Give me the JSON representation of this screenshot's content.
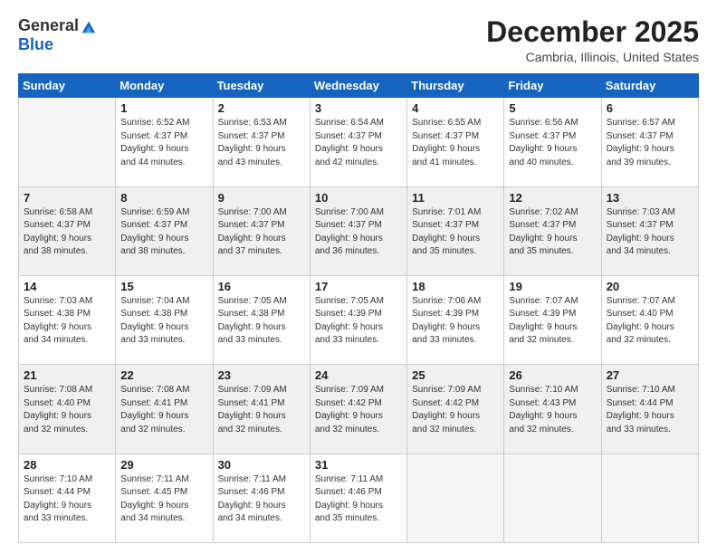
{
  "logo": {
    "general": "General",
    "blue": "Blue"
  },
  "header": {
    "month": "December 2025",
    "location": "Cambria, Illinois, United States"
  },
  "days_of_week": [
    "Sunday",
    "Monday",
    "Tuesday",
    "Wednesday",
    "Thursday",
    "Friday",
    "Saturday"
  ],
  "weeks": [
    [
      {
        "day": "",
        "info": ""
      },
      {
        "day": "1",
        "info": "Sunrise: 6:52 AM\nSunset: 4:37 PM\nDaylight: 9 hours\nand 44 minutes."
      },
      {
        "day": "2",
        "info": "Sunrise: 6:53 AM\nSunset: 4:37 PM\nDaylight: 9 hours\nand 43 minutes."
      },
      {
        "day": "3",
        "info": "Sunrise: 6:54 AM\nSunset: 4:37 PM\nDaylight: 9 hours\nand 42 minutes."
      },
      {
        "day": "4",
        "info": "Sunrise: 6:55 AM\nSunset: 4:37 PM\nDaylight: 9 hours\nand 41 minutes."
      },
      {
        "day": "5",
        "info": "Sunrise: 6:56 AM\nSunset: 4:37 PM\nDaylight: 9 hours\nand 40 minutes."
      },
      {
        "day": "6",
        "info": "Sunrise: 6:57 AM\nSunset: 4:37 PM\nDaylight: 9 hours\nand 39 minutes."
      }
    ],
    [
      {
        "day": "7",
        "info": "Sunrise: 6:58 AM\nSunset: 4:37 PM\nDaylight: 9 hours\nand 38 minutes."
      },
      {
        "day": "8",
        "info": "Sunrise: 6:59 AM\nSunset: 4:37 PM\nDaylight: 9 hours\nand 38 minutes."
      },
      {
        "day": "9",
        "info": "Sunrise: 7:00 AM\nSunset: 4:37 PM\nDaylight: 9 hours\nand 37 minutes."
      },
      {
        "day": "10",
        "info": "Sunrise: 7:00 AM\nSunset: 4:37 PM\nDaylight: 9 hours\nand 36 minutes."
      },
      {
        "day": "11",
        "info": "Sunrise: 7:01 AM\nSunset: 4:37 PM\nDaylight: 9 hours\nand 35 minutes."
      },
      {
        "day": "12",
        "info": "Sunrise: 7:02 AM\nSunset: 4:37 PM\nDaylight: 9 hours\nand 35 minutes."
      },
      {
        "day": "13",
        "info": "Sunrise: 7:03 AM\nSunset: 4:37 PM\nDaylight: 9 hours\nand 34 minutes."
      }
    ],
    [
      {
        "day": "14",
        "info": "Sunrise: 7:03 AM\nSunset: 4:38 PM\nDaylight: 9 hours\nand 34 minutes."
      },
      {
        "day": "15",
        "info": "Sunrise: 7:04 AM\nSunset: 4:38 PM\nDaylight: 9 hours\nand 33 minutes."
      },
      {
        "day": "16",
        "info": "Sunrise: 7:05 AM\nSunset: 4:38 PM\nDaylight: 9 hours\nand 33 minutes."
      },
      {
        "day": "17",
        "info": "Sunrise: 7:05 AM\nSunset: 4:39 PM\nDaylight: 9 hours\nand 33 minutes."
      },
      {
        "day": "18",
        "info": "Sunrise: 7:06 AM\nSunset: 4:39 PM\nDaylight: 9 hours\nand 33 minutes."
      },
      {
        "day": "19",
        "info": "Sunrise: 7:07 AM\nSunset: 4:39 PM\nDaylight: 9 hours\nand 32 minutes."
      },
      {
        "day": "20",
        "info": "Sunrise: 7:07 AM\nSunset: 4:40 PM\nDaylight: 9 hours\nand 32 minutes."
      }
    ],
    [
      {
        "day": "21",
        "info": "Sunrise: 7:08 AM\nSunset: 4:40 PM\nDaylight: 9 hours\nand 32 minutes."
      },
      {
        "day": "22",
        "info": "Sunrise: 7:08 AM\nSunset: 4:41 PM\nDaylight: 9 hours\nand 32 minutes."
      },
      {
        "day": "23",
        "info": "Sunrise: 7:09 AM\nSunset: 4:41 PM\nDaylight: 9 hours\nand 32 minutes."
      },
      {
        "day": "24",
        "info": "Sunrise: 7:09 AM\nSunset: 4:42 PM\nDaylight: 9 hours\nand 32 minutes."
      },
      {
        "day": "25",
        "info": "Sunrise: 7:09 AM\nSunset: 4:42 PM\nDaylight: 9 hours\nand 32 minutes."
      },
      {
        "day": "26",
        "info": "Sunrise: 7:10 AM\nSunset: 4:43 PM\nDaylight: 9 hours\nand 32 minutes."
      },
      {
        "day": "27",
        "info": "Sunrise: 7:10 AM\nSunset: 4:44 PM\nDaylight: 9 hours\nand 33 minutes."
      }
    ],
    [
      {
        "day": "28",
        "info": "Sunrise: 7:10 AM\nSunset: 4:44 PM\nDaylight: 9 hours\nand 33 minutes."
      },
      {
        "day": "29",
        "info": "Sunrise: 7:11 AM\nSunset: 4:45 PM\nDaylight: 9 hours\nand 34 minutes."
      },
      {
        "day": "30",
        "info": "Sunrise: 7:11 AM\nSunset: 4:46 PM\nDaylight: 9 hours\nand 34 minutes."
      },
      {
        "day": "31",
        "info": "Sunrise: 7:11 AM\nSunset: 4:46 PM\nDaylight: 9 hours\nand 35 minutes."
      },
      {
        "day": "",
        "info": ""
      },
      {
        "day": "",
        "info": ""
      },
      {
        "day": "",
        "info": ""
      }
    ]
  ]
}
